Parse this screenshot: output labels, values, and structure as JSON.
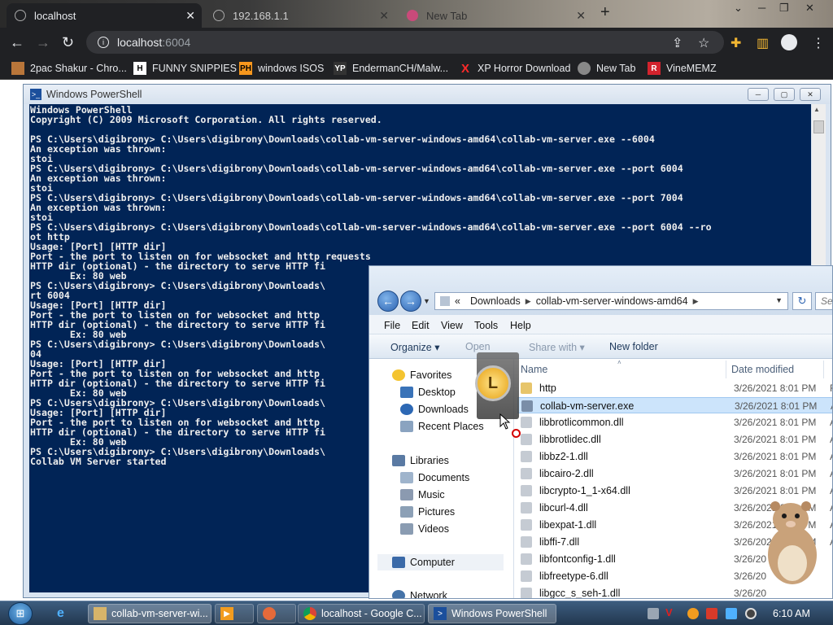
{
  "browser": {
    "tabs": [
      {
        "label": "localhost",
        "active": true
      },
      {
        "label": "192.168.1.1",
        "active": false
      },
      {
        "label": "New Tab",
        "active": false
      }
    ],
    "address": {
      "host": "localhost",
      "port": ":6004"
    },
    "bookmarks": [
      {
        "label": "2pac Shakur - Chro...",
        "icon": "bookmark-icon"
      },
      {
        "label": "FUNNY SNIPPIES",
        "icon": "h-letter-icon"
      },
      {
        "label": "windows ISOS",
        "icon": "ph-icon"
      },
      {
        "label": "EndermanCH/Malw...",
        "icon": "yp-icon"
      },
      {
        "label": "XP Horror Download",
        "icon": "x-icon"
      },
      {
        "label": "New Tab",
        "icon": "globe-icon"
      },
      {
        "label": "VineMEMZ",
        "icon": "r-icon"
      }
    ]
  },
  "powershell": {
    "title": "Windows PowerShell",
    "lines": [
      "Windows PowerShell",
      "Copyright (C) 2009 Microsoft Corporation. All rights reserved.",
      "",
      "PS C:\\Users\\digibrony> C:\\Users\\digibrony\\Downloads\\collab-vm-server-windows-amd64\\collab-vm-server.exe --6004",
      "An exception was thrown:",
      "stoi",
      "PS C:\\Users\\digibrony> C:\\Users\\digibrony\\Downloads\\collab-vm-server-windows-amd64\\collab-vm-server.exe --port 6004",
      "An exception was thrown:",
      "stoi",
      "PS C:\\Users\\digibrony> C:\\Users\\digibrony\\Downloads\\collab-vm-server-windows-amd64\\collab-vm-server.exe --port 7004",
      "An exception was thrown:",
      "stoi",
      "PS C:\\Users\\digibrony> C:\\Users\\digibrony\\Downloads\\collab-vm-server-windows-amd64\\collab-vm-server.exe --port 6004 --ro",
      "ot http",
      "Usage: [Port] [HTTP dir]",
      "Port - the port to listen on for websocket and http requests",
      "HTTP dir (optional) - the directory to serve HTTP fi",
      "       Ex: 80 web",
      "PS C:\\Users\\digibrony> C:\\Users\\digibrony\\Downloads\\",
      "rt 6004",
      "Usage: [Port] [HTTP dir]",
      "Port - the port to listen on for websocket and http",
      "HTTP dir (optional) - the directory to serve HTTP fi",
      "       Ex: 80 web",
      "PS C:\\Users\\digibrony> C:\\Users\\digibrony\\Downloads\\",
      "04",
      "Usage: [Port] [HTTP dir]",
      "Port - the port to listen on for websocket and http",
      "HTTP dir (optional) - the directory to serve HTTP fi",
      "       Ex: 80 web",
      "PS C:\\Users\\digibrony> C:\\Users\\digibrony\\Downloads\\",
      "Usage: [Port] [HTTP dir]",
      "Port - the port to listen on for websocket and http",
      "HTTP dir (optional) - the directory to serve HTTP fi",
      "       Ex: 80 web",
      "PS C:\\Users\\digibrony> C:\\Users\\digibrony\\Downloads\\",
      "Collab VM Server started"
    ]
  },
  "explorer": {
    "breadcrumb": {
      "prefix": "«",
      "parts": [
        "Downloads",
        "collab-vm-server-windows-amd64"
      ]
    },
    "search_placeholder": "Se",
    "menu": [
      "File",
      "Edit",
      "View",
      "Tools",
      "Help"
    ],
    "commands": {
      "organize": "Organize",
      "open": "Open",
      "share": "Share with",
      "new_folder": "New folder"
    },
    "columns": {
      "name": "Name",
      "date": "Date modified"
    },
    "nav": {
      "favorites": "Favorites",
      "desktop": "Desktop",
      "downloads": "Downloads",
      "recent": "Recent Places",
      "libraries": "Libraries",
      "documents": "Documents",
      "music": "Music",
      "pictures": "Pictures",
      "videos": "Videos",
      "computer": "Computer",
      "network": "Network"
    },
    "files": [
      {
        "name": "http",
        "date": "3/26/2021 8:01 PM",
        "type": "F",
        "kind": "folder"
      },
      {
        "name": "collab-vm-server.exe",
        "date": "3/26/2021 8:01 PM",
        "type": "A",
        "kind": "exe",
        "selected": true
      },
      {
        "name": "libbrotlicommon.dll",
        "date": "3/26/2021 8:01 PM",
        "type": "A",
        "kind": "dll"
      },
      {
        "name": "libbrotlidec.dll",
        "date": "3/26/2021 8:01 PM",
        "type": "A",
        "kind": "dll"
      },
      {
        "name": "libbz2-1.dll",
        "date": "3/26/2021 8:01 PM",
        "type": "A",
        "kind": "dll"
      },
      {
        "name": "libcairo-2.dll",
        "date": "3/26/2021 8:01 PM",
        "type": "A",
        "kind": "dll"
      },
      {
        "name": "libcrypto-1_1-x64.dll",
        "date": "3/26/2021 8:01 PM",
        "type": "A",
        "kind": "dll"
      },
      {
        "name": "libcurl-4.dll",
        "date": "3/26/2021 8:01 PM",
        "type": "A",
        "kind": "dll"
      },
      {
        "name": "libexpat-1.dll",
        "date": "3/26/2021 8:01 PM",
        "type": "A",
        "kind": "dll"
      },
      {
        "name": "libffi-7.dll",
        "date": "3/26/2021 8:01 PM",
        "type": "A",
        "kind": "dll"
      },
      {
        "name": "libfontconfig-1.dll",
        "date": "3/26/20",
        "type": "",
        "kind": "dll"
      },
      {
        "name": "libfreetype-6.dll",
        "date": "3/26/20",
        "type": "",
        "kind": "dll"
      },
      {
        "name": "libgcc_s_seh-1.dll",
        "date": "3/26/20",
        "type": "",
        "kind": "dll"
      }
    ]
  },
  "taskbar": {
    "items": [
      {
        "label": "collab-vm-server-wi...",
        "icon": "folder-icon"
      },
      {
        "label": "",
        "icon": "media-player-icon"
      },
      {
        "label": "",
        "icon": "paint-icon"
      },
      {
        "label": "localhost - Google C...",
        "icon": "chrome-icon"
      },
      {
        "label": "Windows PowerShell",
        "icon": "powershell-icon"
      }
    ],
    "clock": "6:10 AM"
  },
  "colors": {
    "console_bg": "#012456",
    "console_fg": "#eeeeee",
    "chrome_dark": "#202124",
    "selection": "#cce4fb"
  }
}
